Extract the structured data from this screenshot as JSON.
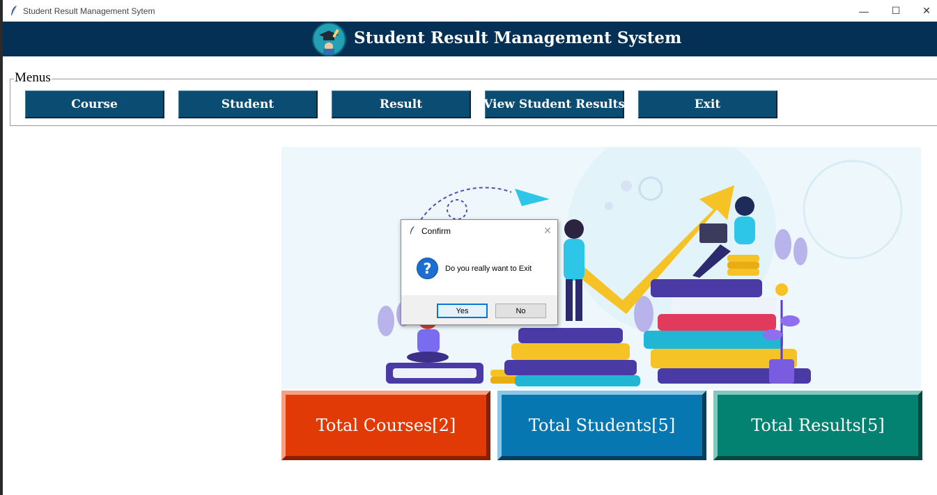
{
  "window": {
    "title": "Student Result Management Sytem",
    "minimize_glyph": "—",
    "maximize_glyph": "☐",
    "close_glyph": "✕"
  },
  "header": {
    "title": "Student Result Management System",
    "logo_icon": "graduation-cap-logo-icon"
  },
  "menus": {
    "legend": "Menus",
    "buttons": [
      {
        "label": "Course"
      },
      {
        "label": "Student"
      },
      {
        "label": "Result"
      },
      {
        "label": "View Student Results"
      },
      {
        "label": "Exit"
      }
    ]
  },
  "stats": {
    "courses": "Total Courses[2]",
    "students": "Total Students[5]",
    "results": "Total Results[5]"
  },
  "colors": {
    "header_bg": "#033054",
    "menu_button_bg": "#0b4c72",
    "courses_bg": "#e23a06",
    "students_bg": "#0677b0",
    "results_bg": "#038271"
  },
  "dialog": {
    "title": "Confirm",
    "icon": "question-icon",
    "icon_glyph": "?",
    "message": "Do you really want to Exit",
    "close_glyph": "✕",
    "yes_label": "Yes",
    "no_label": "No"
  }
}
